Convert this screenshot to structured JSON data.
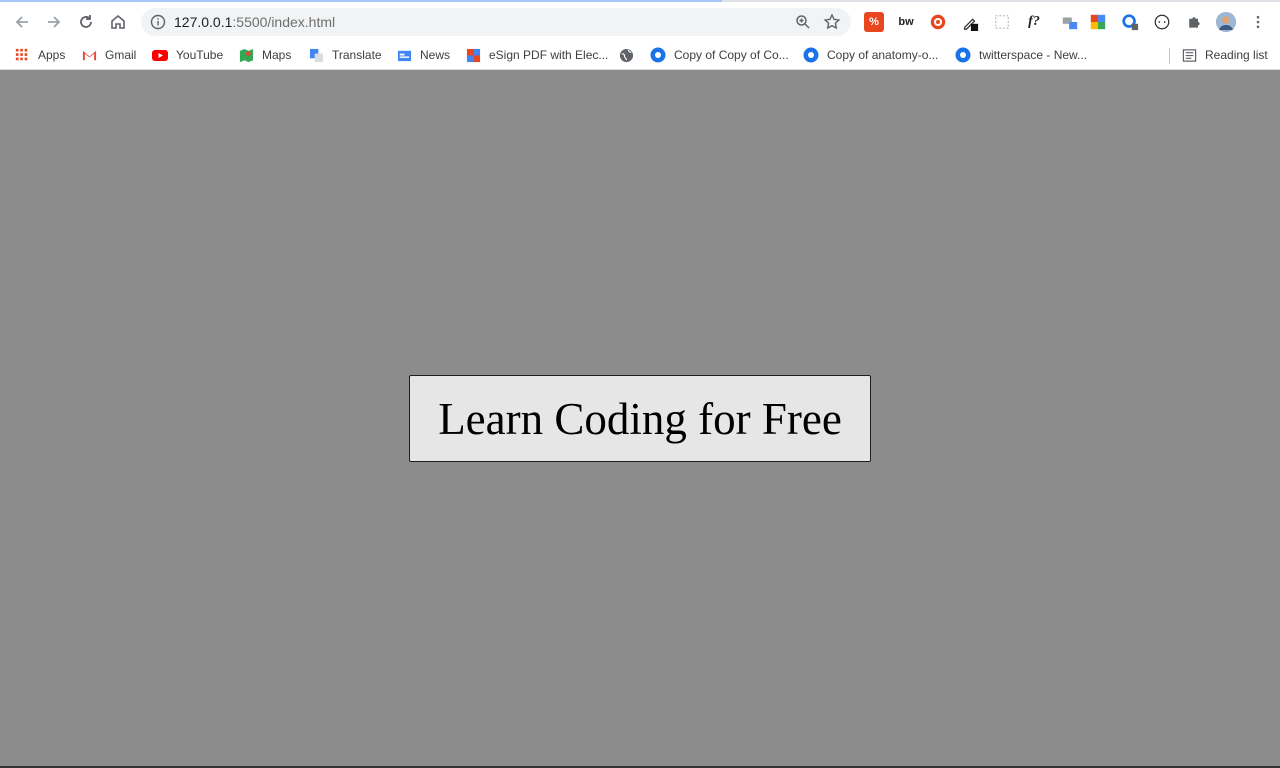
{
  "browser": {
    "url_host": "127.0.0.1",
    "url_path": ":5500/index.html",
    "bookmarks": [
      {
        "label": "Apps",
        "icon": "apps-grid-icon"
      },
      {
        "label": "Gmail",
        "icon": "gmail-icon"
      },
      {
        "label": "YouTube",
        "icon": "youtube-icon"
      },
      {
        "label": "Maps",
        "icon": "maps-icon"
      },
      {
        "label": "Translate",
        "icon": "translate-icon"
      },
      {
        "label": "News",
        "icon": "news-icon"
      },
      {
        "label": "eSign PDF with Elec...",
        "icon": "esign-icon"
      },
      {
        "label": "",
        "icon": "globe-icon"
      },
      {
        "label": "Copy of Copy of Co...",
        "icon": "chrome-doc-icon"
      },
      {
        "label": "Copy of anatomy-o...",
        "icon": "chrome-doc-icon"
      },
      {
        "label": "twitterspace - New...",
        "icon": "chrome-doc-icon"
      }
    ],
    "reading_list": "Reading list",
    "extensions": [
      {
        "label": "%",
        "icon": "percent-extension-icon"
      },
      {
        "label": "bw",
        "icon": "bw-extension-icon"
      },
      {
        "label": "",
        "icon": "target-extension-icon"
      },
      {
        "label": "",
        "icon": "eyedropper-extension-icon"
      },
      {
        "label": "",
        "icon": "dotted-square-extension-icon"
      },
      {
        "label": "f?",
        "icon": "font-extension-icon"
      },
      {
        "label": "",
        "icon": "translate-extension-icon"
      },
      {
        "label": "",
        "icon": "color-grid-extension-icon"
      },
      {
        "label": "",
        "icon": "gear-badge-extension-icon"
      },
      {
        "label": "",
        "icon": "circle-dots-extension-icon"
      },
      {
        "label": "",
        "icon": "puzzle-icon"
      },
      {
        "label": "",
        "icon": "profile-avatar-icon"
      },
      {
        "label": "",
        "icon": "kebab-menu-icon"
      }
    ]
  },
  "page": {
    "button_label": "Learn Coding for Free"
  },
  "colors": {
    "page_background": "#8c8c8c",
    "button_background": "#e6e6e6"
  }
}
